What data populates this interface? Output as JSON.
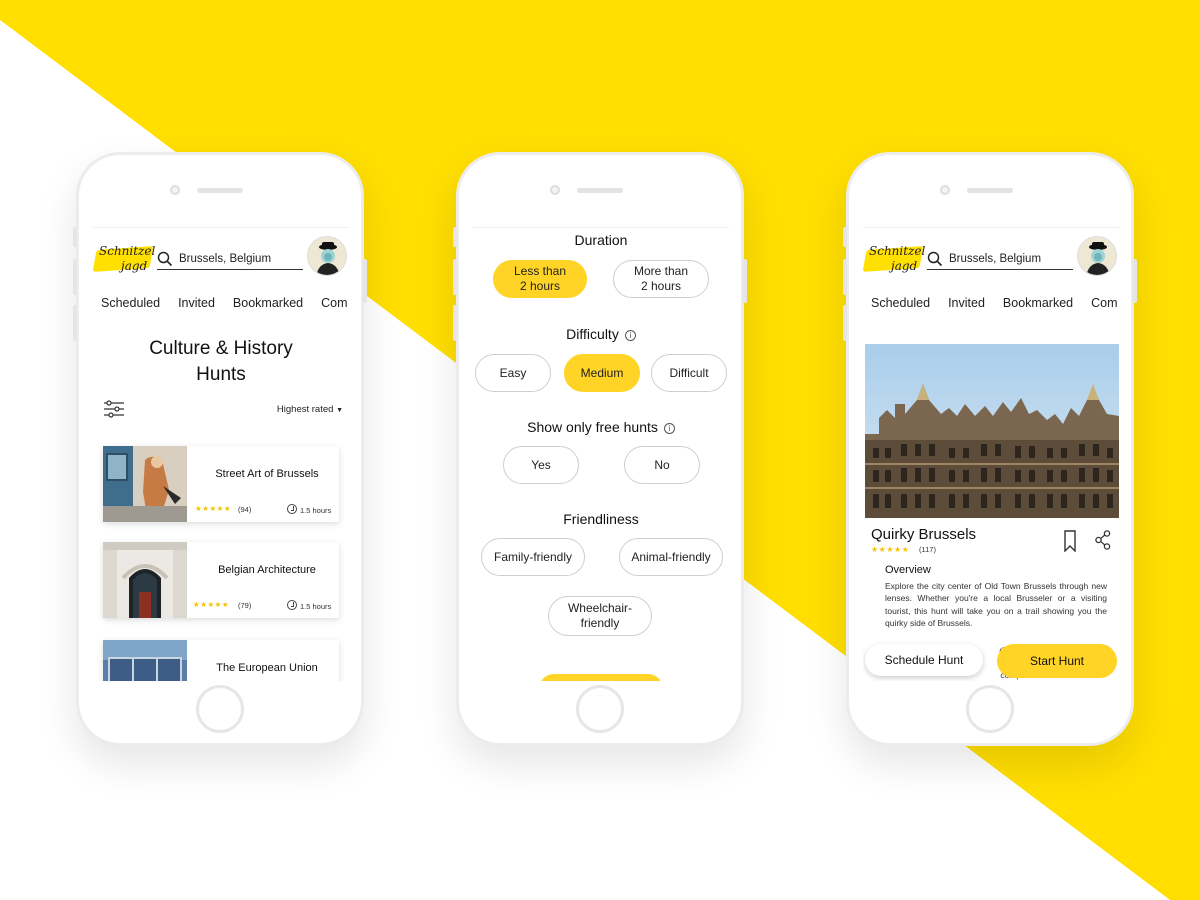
{
  "colors": {
    "accent": "#FFDE00",
    "pill_active": "#FFD426",
    "star": "#F5C400"
  },
  "header": {
    "logo_line1": "Schnitzel",
    "logo_line2": "jagd",
    "search_value": "Brussels, Belgium",
    "search_icon": "search-icon",
    "avatar_icon": "user-avatar"
  },
  "tabs": [
    "Scheduled",
    "Invited",
    "Bookmarked",
    "Com"
  ],
  "screen1": {
    "title_line1": "Culture & History",
    "title_line2": "Hunts",
    "filter_icon": "filter-sliders-icon",
    "sort_label": "Highest rated",
    "cards": [
      {
        "name": "Street Art of Brussels",
        "rating": 5,
        "count": "(94)",
        "duration": "1.5 hours"
      },
      {
        "name": "Belgian Architecture",
        "rating": 5,
        "count": "(79)",
        "duration": "1.5 hours"
      },
      {
        "name": "The European Union"
      }
    ]
  },
  "screen2": {
    "duration_label": "Duration",
    "duration_options": [
      {
        "line1": "Less than",
        "line2": "2 hours",
        "selected": true
      },
      {
        "line1": "More than",
        "line2": "2 hours",
        "selected": false
      }
    ],
    "difficulty_label": "Difficulty",
    "difficulty_options": [
      {
        "label": "Easy",
        "selected": false
      },
      {
        "label": "Medium",
        "selected": true
      },
      {
        "label": "Difficult",
        "selected": false
      }
    ],
    "free_label": "Show only free hunts",
    "free_options": [
      {
        "label": "Yes",
        "selected": false
      },
      {
        "label": "No",
        "selected": false
      }
    ],
    "friendliness_label": "Friendliness",
    "friendliness_options": [
      {
        "label": "Family-friendly",
        "selected": false
      },
      {
        "label": "Animal-friendly",
        "selected": false
      },
      {
        "line1": "Wheelchair-",
        "line2": "friendly",
        "selected": false
      }
    ],
    "info_icon": "info-icon"
  },
  "screen3": {
    "hunt_title": "Quirky Brussels",
    "rating": 5,
    "count": "(117)",
    "bookmark_icon": "bookmark-icon",
    "share_icon": "share-icon",
    "overview_heading": "Overview",
    "overview_text": "Explore the city center of Old Town Brussels through new lenses. Whether you're a local Brusseler or a visiting tourist, this hunt will take you on a trail showing you the quirky side of Brussels.",
    "overview_more_1": "d Plac",
    "overview_more_2": "off-",
    "overview_more_3": "compl",
    "schedule_button": "Schedule Hunt",
    "start_button": "Start Hunt"
  }
}
